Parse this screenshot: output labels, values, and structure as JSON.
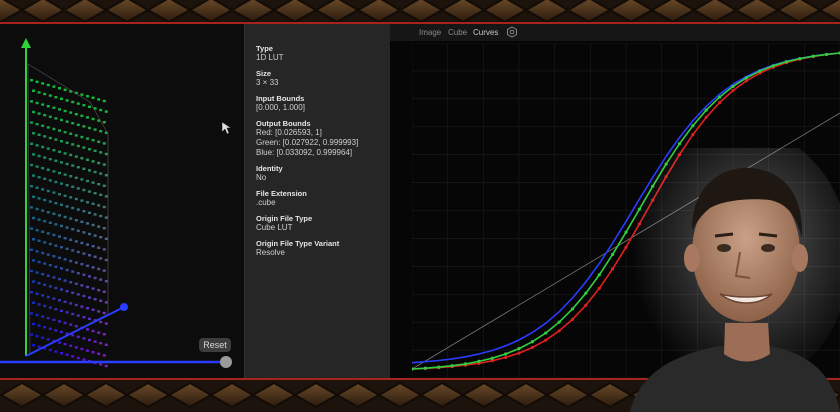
{
  "info": {
    "fields": [
      {
        "label": "Type",
        "values": [
          "1D LUT"
        ]
      },
      {
        "label": "Size",
        "values": [
          "3 × 33"
        ]
      },
      {
        "label": "Input Bounds",
        "values": [
          "[0.000, 1.000]"
        ]
      },
      {
        "label": "Output Bounds",
        "values": [
          "Red: [0.026593, 1]",
          "Green: [0.027922, 0.999993]",
          "Blue: [0.033092, 0.999964]"
        ]
      },
      {
        "label": "Identity",
        "values": [
          "No"
        ]
      },
      {
        "label": "File Extension",
        "values": [
          ".cube"
        ]
      },
      {
        "label": "Origin File Type",
        "values": [
          "Cube LUT"
        ]
      },
      {
        "label": "Origin File Type Variant",
        "values": [
          "Resolve"
        ]
      }
    ]
  },
  "cube_panel": {
    "reset_label": "Reset"
  },
  "curves_panel": {
    "tabs": [
      {
        "label": "Image",
        "active": false
      },
      {
        "label": "Cube",
        "active": false
      },
      {
        "label": "Curves",
        "active": true
      }
    ],
    "settings_icon": "hexagon-gear-icon"
  },
  "colors": {
    "red": "#e02020",
    "green": "#30d040",
    "blue": "#2a3cff",
    "accent_line": "#a8231d"
  },
  "icons": {
    "cursor": "cursor-arrow-icon",
    "reset_slider": "slider-knob-icon"
  }
}
